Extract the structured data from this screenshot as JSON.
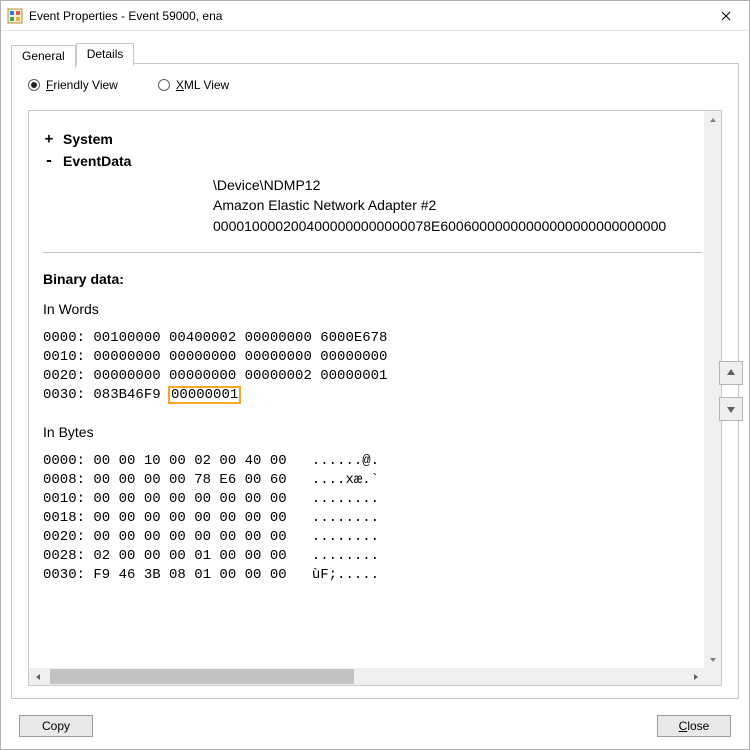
{
  "window": {
    "title": "Event Properties - Event 59000, ena"
  },
  "tabs": {
    "general": "General",
    "details": "Details"
  },
  "view": {
    "friendly_pre": "F",
    "friendly_rest": "riendly View",
    "xml_pre": "X",
    "xml_rest": "ML View"
  },
  "tree": {
    "system_toggle": "+",
    "system_label": "System",
    "eventdata_toggle": "-",
    "eventdata_label": "EventData",
    "values": {
      "device": "\\Device\\NDMP12",
      "adapter": "Amazon Elastic Network Adapter #2",
      "raw": "0000100002004000000000000078E60060000000000000000000000000"
    }
  },
  "binary": {
    "title": "Binary data:",
    "words_label": "In Words",
    "bytes_label": "In Bytes",
    "words_lines": [
      "0000: 00100000 00400002 00000000 6000E678",
      "0010: 00000000 00000000 00000000 00000000",
      "0020: 00000000 00000000 00000002 00000001"
    ],
    "words_last_prefix": "0030: 083B46F9 ",
    "words_last_highlight": "00000001",
    "bytes_lines": [
      "0000: 00 00 10 00 02 00 40 00   ......@.",
      "0008: 00 00 00 00 78 E6 00 60   ....xæ.`",
      "0010: 00 00 00 00 00 00 00 00   ........",
      "0018: 00 00 00 00 00 00 00 00   ........",
      "0020: 00 00 00 00 00 00 00 00   ........",
      "0028: 02 00 00 00 01 00 00 00   ........",
      "0030: F9 46 3B 08 01 00 00 00   ùF;....."
    ]
  },
  "buttons": {
    "copy": "Copy",
    "close_pre": "C",
    "close_rest": "lose"
  }
}
